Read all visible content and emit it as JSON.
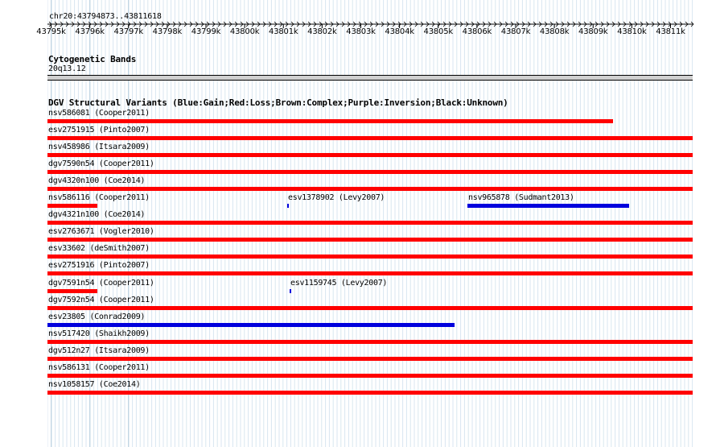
{
  "ruler": {
    "location": "chr20:43794873..43811618",
    "ticks": [
      "43795k",
      "43796k",
      "43797k",
      "43798k",
      "43799k",
      "43800k",
      "43801k",
      "43802k",
      "43803k",
      "43804k",
      "43805k",
      "43806k",
      "43807k",
      "43808k",
      "43809k",
      "43810k",
      "43811k"
    ]
  },
  "cytobands": {
    "title": "Cytogenetic Bands",
    "band": "20q13.12"
  },
  "dgv": {
    "title": "DGV Structural Variants (Blue:Gain;Red:Loss;Brown:Complex;Purple:Inversion;Black:Unknown)",
    "colors": {
      "loss": "#ff0000",
      "gain": "#0000dd"
    },
    "features": [
      {
        "label": "nsv586081 (Cooper2011)",
        "type": "loss",
        "start": 43794873,
        "end": 43809560
      },
      {
        "label": "esv2751915 (Pinto2007)",
        "type": "loss",
        "start": 43794873,
        "end": 43811618
      },
      {
        "label": "nsv458986 (Itsara2009)",
        "type": "loss",
        "start": 43794873,
        "end": 43811618
      },
      {
        "label": "dgv7590n54 (Cooper2011)",
        "type": "loss",
        "start": 43794873,
        "end": 43811618
      },
      {
        "label": "dgv4320n100 (Coe2014)",
        "type": "loss",
        "start": 43794873,
        "end": 43811618
      },
      {
        "label": "nsv586116 (Cooper2011)",
        "type": "loss",
        "start": 43794873,
        "end": 43796170
      },
      {
        "label": "esv1378902 (Levy2007)",
        "type": "gain",
        "start": 43801090,
        "end": 43801140
      },
      {
        "label": "nsv965878 (Sudmant2013)",
        "type": "gain",
        "start": 43805770,
        "end": 43809970
      },
      {
        "label": "dgv4321n100 (Coe2014)",
        "type": "loss",
        "start": 43794873,
        "end": 43811618
      },
      {
        "label": "esv2763671 (Vogler2010)",
        "type": "loss",
        "start": 43794873,
        "end": 43811618
      },
      {
        "label": "esv33602 (deSmith2007)",
        "type": "loss",
        "start": 43794873,
        "end": 43811618
      },
      {
        "label": "esv2751916 (Pinto2007)",
        "type": "loss",
        "start": 43794873,
        "end": 43811618
      },
      {
        "label": "dgv7591n54 (Cooper2011)",
        "type": "loss",
        "start": 43794873,
        "end": 43796170
      },
      {
        "label": "esv1159745 (Levy2007)",
        "type": "gain",
        "start": 43801150,
        "end": 43801200
      },
      {
        "label": "dgv7592n54 (Cooper2011)",
        "type": "loss",
        "start": 43794873,
        "end": 43811618
      },
      {
        "label": "esv23805 (Conrad2009)",
        "type": "gain",
        "start": 43794873,
        "end": 43805440
      },
      {
        "label": "nsv517420 (Shaikh2009)",
        "type": "loss",
        "start": 43794873,
        "end": 43811618
      },
      {
        "label": "dgv512n27 (Itsara2009)",
        "type": "loss",
        "start": 43794873,
        "end": 43811618
      },
      {
        "label": "nsv586131 (Cooper2011)",
        "type": "loss",
        "start": 43794873,
        "end": 43811618
      },
      {
        "label": "nsv1058157 (Coe2014)",
        "type": "loss",
        "start": 43794873,
        "end": 43811618
      }
    ]
  }
}
